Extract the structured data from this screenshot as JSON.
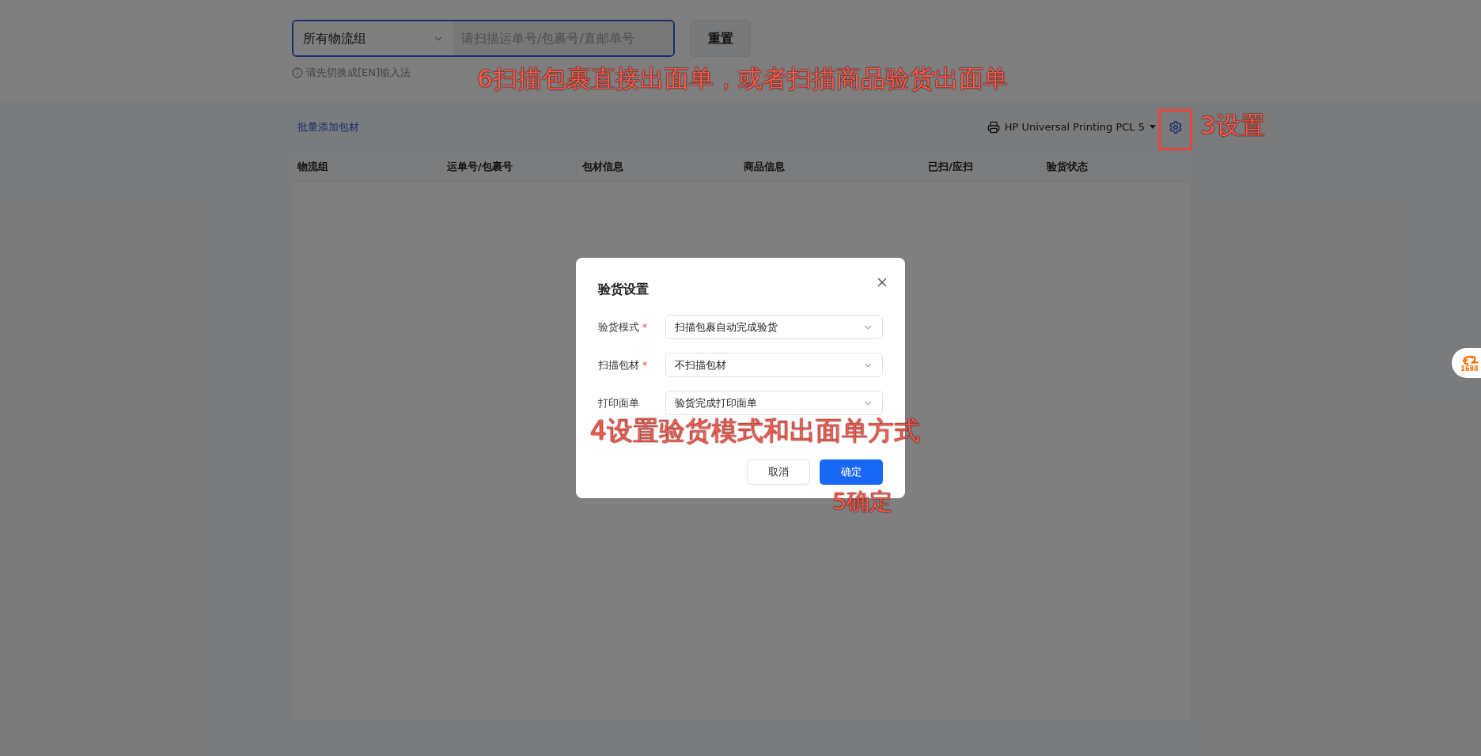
{
  "search_bar": {
    "group_select": "所有物流组",
    "scan_input": {
      "placeholder": "请扫描运单号/包裹号/直邮单号"
    },
    "reset_button": "重置",
    "hint": "请先切换成[EN]输入法"
  },
  "logo_badge": "1688",
  "toolbar": {
    "batch_link": "批量添加包材",
    "printer": "HP Universal Printing PCL 5"
  },
  "table": {
    "columns": [
      "物流组",
      "运单号/包裹号",
      "包材信息",
      "商品信息",
      "已扫/应扫",
      "验货状态"
    ]
  },
  "dialog": {
    "title": "验货设置",
    "fields": [
      {
        "label": "验货模式",
        "required_mark": "*",
        "value": "扫描包裹自动完成验货"
      },
      {
        "label": "扫描包材",
        "required_mark": "*",
        "value": "不扫描包材"
      },
      {
        "label": "打印面单",
        "value": "验货完成打印面单"
      }
    ],
    "buttons": [
      {
        "label": "取消",
        "kind": "secondary"
      },
      {
        "label": "确定",
        "kind": "primary"
      }
    ]
  },
  "annotations": [
    {
      "text": "6扫描包裹直接出面单，或者扫描商品验货出面单",
      "kind": "scan"
    },
    {
      "text": "3设置",
      "kind": "settings"
    },
    {
      "text": "4设置验货模式和出面单方式",
      "kind": "mode"
    },
    {
      "text": "5确定",
      "kind": "confirm"
    }
  ]
}
